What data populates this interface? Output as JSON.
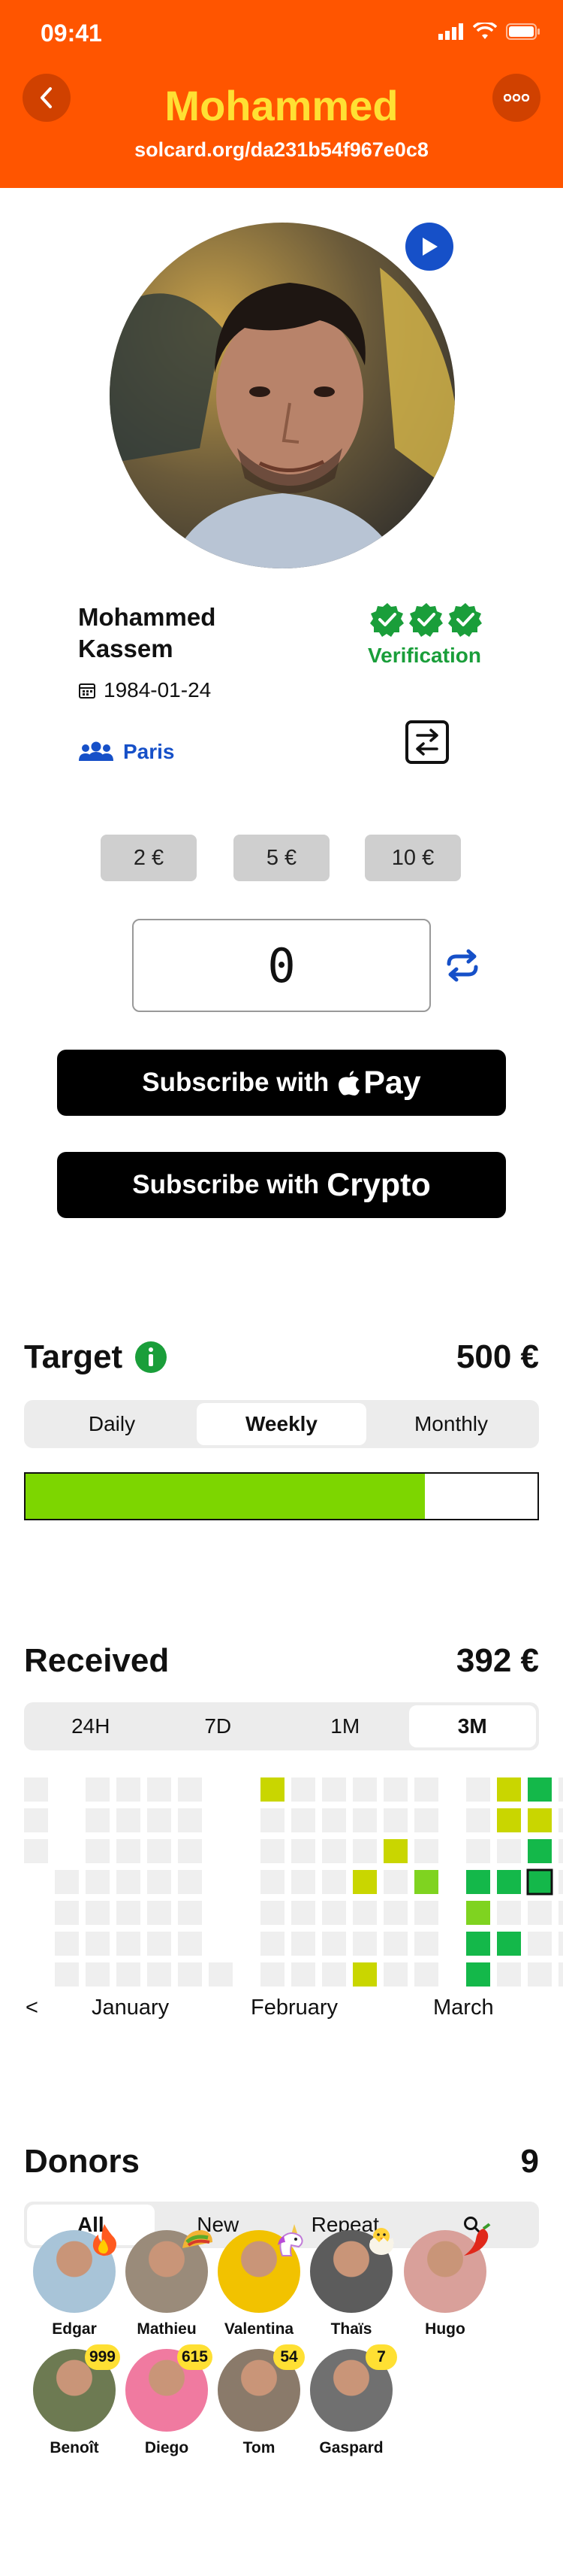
{
  "status": {
    "time": "09:41"
  },
  "header": {
    "title": "Mohammed",
    "url": "solcard.org/da231b54f967e0c8",
    "bg_color": "#ff5500",
    "title_color": "#ffe033"
  },
  "profile": {
    "full_name": "Mohammed Kassem",
    "dob": "1984-01-24",
    "city": "Paris",
    "verification_label": "Verification",
    "verification_checks": 3
  },
  "amounts": {
    "chips": [
      "2 €",
      "5 €",
      "10 €"
    ],
    "current": "0"
  },
  "buttons": {
    "apple_pay_prefix": "Subscribe with",
    "apple_pay_brand": "Pay",
    "crypto_prefix": "Subscribe with",
    "crypto_brand": "Crypto"
  },
  "target": {
    "title": "Target",
    "value": "500 €",
    "tabs": [
      "Daily",
      "Weekly",
      "Monthly"
    ],
    "active_tab": 1,
    "progress": 0.78,
    "progress_color": "#7dd600"
  },
  "received": {
    "title": "Received",
    "value": "392 €",
    "tabs": [
      "24H",
      "7D",
      "1M",
      "3M"
    ],
    "active_tab": 3,
    "months": [
      "January",
      "February",
      "March"
    ],
    "nav_prev": "<",
    "heatmap": {
      "legend_colors": {
        "empty": "#efefef",
        "low": "#c9d600",
        "mid": "#7fd320",
        "high": "#14b84a"
      },
      "weeks": [
        [
          "e",
          "e",
          "e",
          "n",
          "n",
          "n",
          "n"
        ],
        [
          "n",
          "n",
          "n",
          "e",
          "e",
          "e",
          "e"
        ],
        [
          "e",
          "e",
          "e",
          "e",
          "e",
          "e",
          "e"
        ],
        [
          "e",
          "e",
          "e",
          "e",
          "e",
          "e",
          "e"
        ],
        [
          "e",
          "e",
          "e",
          "e",
          "e",
          "e",
          "e"
        ],
        [
          "e",
          "e",
          "e",
          "e",
          "e",
          "e",
          "e"
        ],
        [
          "n",
          "n",
          "n",
          "n",
          "n",
          "n",
          "e"
        ],
        [
          "l",
          "e",
          "e",
          "e",
          "e",
          "e",
          "e"
        ],
        [
          "e",
          "e",
          "e",
          "e",
          "e",
          "e",
          "e"
        ],
        [
          "e",
          "e",
          "e",
          "e",
          "e",
          "e",
          "e"
        ],
        [
          "e",
          "e",
          "e",
          "l",
          "e",
          "e",
          "l"
        ],
        [
          "e",
          "e",
          "l",
          "e",
          "e",
          "e",
          "e"
        ],
        [
          "e",
          "e",
          "e",
          "m",
          "e",
          "e",
          "e"
        ],
        [
          "e",
          "e",
          "e",
          "h",
          "m",
          "h",
          "h"
        ],
        [
          "l",
          "l",
          "e",
          "h",
          "e",
          "h",
          "e"
        ],
        [
          "h",
          "l",
          "h",
          "s",
          "e",
          "e",
          "e"
        ],
        [
          "e",
          "e",
          "e",
          "e",
          "e",
          "e",
          "e"
        ]
      ]
    }
  },
  "donors": {
    "title": "Donors",
    "count": "9",
    "tabs": [
      "All",
      "New",
      "Repeat"
    ],
    "active_tab": 0,
    "list": [
      {
        "name": "Edgar",
        "color": "#a8c4d8",
        "emoji": "fire"
      },
      {
        "name": "Mathieu",
        "color": "#9a8b7a",
        "emoji": "taco"
      },
      {
        "name": "Valentina",
        "color": "#f2c200",
        "emoji": "unicorn"
      },
      {
        "name": "Thaïs",
        "color": "#5c5c5c",
        "emoji": "chick"
      },
      {
        "name": "Hugo",
        "color": "#d9a09a",
        "emoji": "pepper"
      },
      {
        "name": "Benoît",
        "color": "#6d7a52",
        "badge": "999"
      },
      {
        "name": "Diego",
        "color": "#f07aa0",
        "badge": "615"
      },
      {
        "name": "Tom",
        "color": "#8a7a6a",
        "badge": "54"
      },
      {
        "name": "Gaspard",
        "color": "#707070",
        "badge": "7"
      }
    ]
  }
}
